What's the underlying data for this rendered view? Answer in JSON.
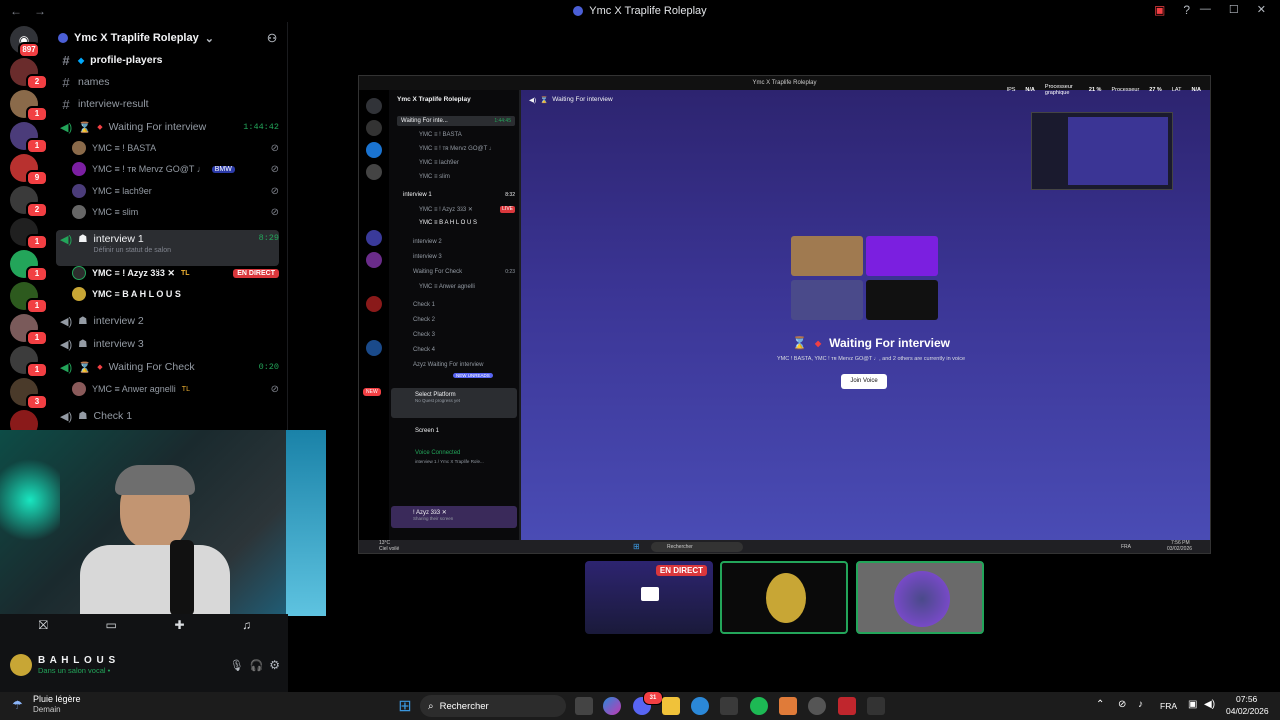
{
  "window": {
    "title": "Ymc X Traplife Roleplay"
  },
  "rail": {
    "home_badge": "897",
    "servers": [
      {
        "badge": "2"
      },
      {
        "badge": "1"
      },
      {
        "badge": "1"
      },
      {
        "badge": "9"
      },
      {
        "badge": "2"
      },
      {
        "badge": "1"
      },
      {
        "badge": "1"
      },
      {
        "badge": "1"
      },
      {
        "badge": "1"
      },
      {
        "badge": "1"
      },
      {
        "badge": "3"
      },
      {
        "badge": "2"
      }
    ]
  },
  "sidebar": {
    "server_name": "Ymc X Traplife Roleplay",
    "channels": {
      "profile_players": "profile-players",
      "names": "names",
      "interview_result": "interview-result",
      "waiting": {
        "name": "Waiting For interview",
        "timer": "1:44:42"
      },
      "waiting_users": [
        "YMC ≡ ! BASTA",
        "YMC ≡ ! ᴛʀ Mervz GO@T ♩",
        "YMC ≡ lach9er",
        "YMC ≡ slim"
      ],
      "waiting_user_tag": "BMW",
      "interview1": {
        "name": "interview 1",
        "timer": "8:29",
        "status": "Définir un statut de salon"
      },
      "interview1_users": [
        "YMC ≡ ! Azyz 3ӟ3 ✕",
        "YMC ≡ B A H L O U S"
      ],
      "live_badge": "EN DIRECT",
      "tl_tag": "TL",
      "interview2": "interview 2",
      "interview3": "interview 3",
      "waiting_check": {
        "name": "Waiting For Check",
        "timer": "0:20"
      },
      "check_user": "YMC ≡ Anwer agnelli",
      "check1": "Check 1"
    }
  },
  "user_panel": {
    "name": "B A H L O U S",
    "status": "Dans un salon vocal •"
  },
  "stream": {
    "window_title": "Ymc X Traplife Roleplay",
    "channel_header": "Waiting For interview",
    "stats": {
      "ips_label": "IPS",
      "ips": "N/A",
      "gpu_label": "Processeur graphique",
      "gpu": "21 %",
      "cpu_label": "Processeur",
      "cpu": "27 %",
      "lat_label": "LAT",
      "lat": "N/A"
    },
    "side_items": [
      "Waiting For inte...",
      "YMC ≡ ! BASTA",
      "YMC ≡ ! ᴛʀ Mervz GO@T ♩",
      "YMC ≡ lach9er",
      "YMC ≡ slim",
      "interview 1",
      "YMC ≡ ! Azyz 3ӟ3 ✕",
      "YMC ≡ B A H L O U S",
      "interview 2",
      "interview 3",
      "Waiting For Check",
      "YMC ≡ Anwer agnelli",
      "Check 1",
      "Check 2",
      "Check 3",
      "Check 4",
      "Azyz Waiting For interview"
    ],
    "side_timer": "1:44:45",
    "side_timer2": "8:32",
    "side_timer3": "0:23",
    "new_label": "NEW",
    "new_unreads": "NEW UNREADS",
    "live": "LIVE",
    "select_platform": "Select Platform",
    "select_platform_sub": "No Quest progress yet",
    "screen_label": "Screen 1",
    "voice_connected": "Voice Connected",
    "voice_sub": "interview 1 / Ymc X Traplife Role...",
    "stream_user": "! Azyz 3ӟ3 ✕",
    "stream_user_sub": "Sharing their screen",
    "main_title": "Waiting For interview",
    "main_sub": "YMC    ! BASTA, YMC    ! ᴛʀ Mervz GO@T ♩, and 2 others are currently in voice",
    "join_button": "Join Voice",
    "taskbar_search": "Rechercher",
    "weather": "13°C",
    "weather_sub": "Ciel voilé",
    "lang": "FRA",
    "time": "7:56 PM",
    "date": "03/02/2026"
  },
  "thumbnails": {
    "live": "EN DIRECT"
  },
  "taskbar": {
    "weather": "Pluie légère",
    "weather_sub": "Demain",
    "search": "Rechercher",
    "discord_badge": "31",
    "lang": "FRA",
    "time": "07:56",
    "date": "04/02/2026"
  }
}
